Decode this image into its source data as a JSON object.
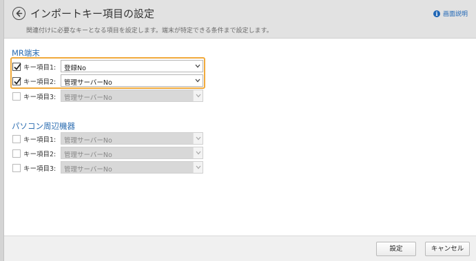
{
  "header": {
    "title": "インポートキー項目の設定",
    "subtitle": "関連付けに必要なキーとなる項目を設定します。端末が特定できる条件まで設定します。",
    "help_label": "画面説明"
  },
  "sections": [
    {
      "title": "MR端末",
      "rows": [
        {
          "label": "キー項目1:",
          "checked": true,
          "value": "登録No",
          "disabled": false
        },
        {
          "label": "キー項目2:",
          "checked": true,
          "value": "管理サーバーNo",
          "disabled": false
        },
        {
          "label": "キー項目3:",
          "checked": false,
          "value": "管理サーバーNo",
          "disabled": true
        }
      ]
    },
    {
      "title": "パソコン周辺機器",
      "rows": [
        {
          "label": "キー項目1:",
          "checked": false,
          "value": "管理サーバーNo",
          "disabled": true
        },
        {
          "label": "キー項目2:",
          "checked": false,
          "value": "管理サーバーNo",
          "disabled": true
        },
        {
          "label": "キー項目3:",
          "checked": false,
          "value": "管理サーバーNo",
          "disabled": true
        }
      ]
    }
  ],
  "footer": {
    "save_label": "設定",
    "cancel_label": "キャンセル"
  },
  "colors": {
    "accent": "#2b6cb0",
    "highlight": "#f0a93a"
  }
}
